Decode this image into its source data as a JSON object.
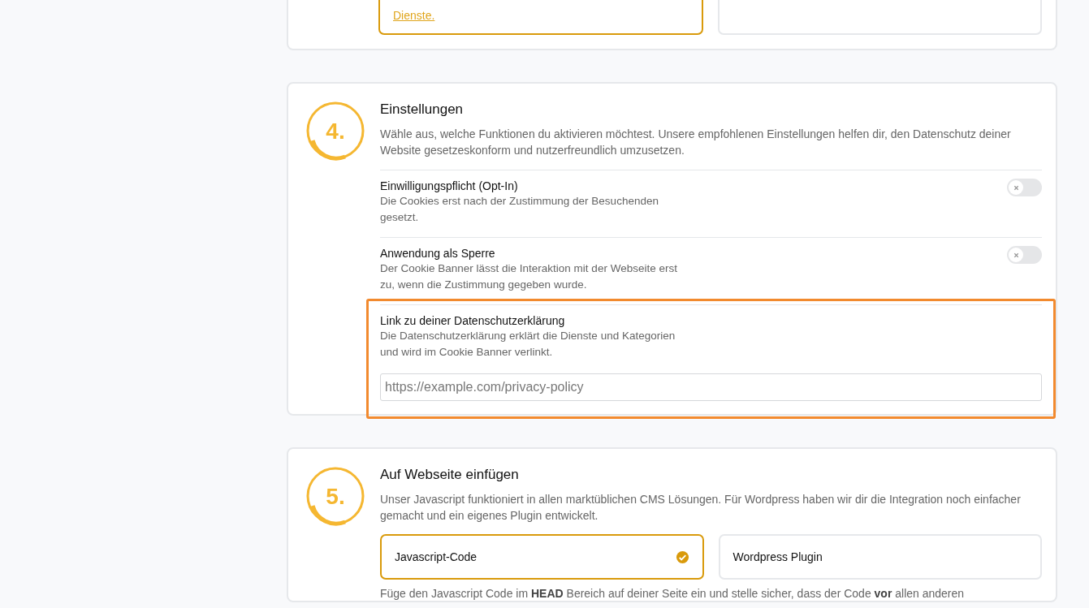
{
  "top_section": {
    "options": [
      {
        "link": "Dienste.",
        "selected": true
      },
      {
        "selected": false
      }
    ]
  },
  "settings_section": {
    "step": "4.",
    "title": "Einstellungen",
    "description": "Wähle aus, welche Funktionen du aktivieren möchtest. Unsere empfohlenen Einstellungen helfen dir, den Datenschutz deiner Website gesetzeskonform und nutzerfreundlich umzusetzen.",
    "toggles": [
      {
        "label": "Einwilligungspflicht (Opt-In)",
        "description": "Die Cookies erst nach der Zustimmung der Besuchenden gesetzt.",
        "on": false
      },
      {
        "label": "Anwendung als Sperre",
        "description": "Der Cookie Banner lässt die Interaktion mit der Webseite erst zu, wenn die Zustimmung gegeben wurde.",
        "on": false
      }
    ],
    "privacy_link": {
      "label": "Link zu deiner Datenschutzerklärung",
      "description": "Die Datenschutzerklärung erklärt die Dienste und Kategorien und wird im Cookie Banner verlinkt.",
      "placeholder": "https://example.com/privacy-policy",
      "highlighted": true
    }
  },
  "embed_section": {
    "step": "5.",
    "title": "Auf Webseite einfügen",
    "description": "Unser Javascript funktioniert in allen marktüblichen CMS Lösungen. Für Wordpress haben wir dir die Integration noch einfacher gemacht und ein eigenes Plugin entwickelt.",
    "options": [
      {
        "label": "Javascript-Code",
        "selected": true
      },
      {
        "label": "Wordpress Plugin",
        "selected": false
      }
    ],
    "instructions": "Füge den Javascript Code im **HEAD** Bereich auf deiner Seite ein und stelle sicher, dass der Code **vor** allen anderen"
  }
}
